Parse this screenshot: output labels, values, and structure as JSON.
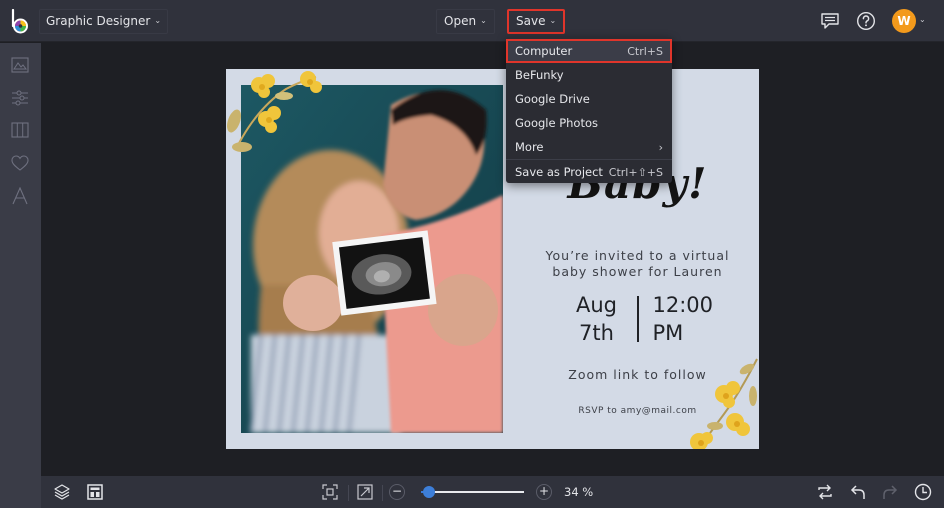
{
  "app": {
    "name": "BeFunky",
    "mode_label": "Graphic Designer"
  },
  "topbar": {
    "open_label": "Open",
    "save_label": "Save",
    "avatar_initial": "W",
    "icons": [
      "befunky-logo-icon",
      "comments-icon",
      "help-icon",
      "avatar"
    ],
    "colors": {
      "highlight": "#e0352b",
      "avatar": "#f39a1c",
      "accent": "#3d7fd9"
    }
  },
  "save_menu": {
    "items": [
      {
        "label": "Computer",
        "shortcut": "Ctrl+S",
        "highlighted": true
      },
      {
        "label": "BeFunky",
        "shortcut": ""
      },
      {
        "label": "Google Drive",
        "shortcut": ""
      },
      {
        "label": "Google Photos",
        "shortcut": ""
      },
      {
        "label": "More",
        "shortcut": "",
        "submenu": true,
        "submenu_glyph": "›"
      },
      {
        "label": "Save as Project",
        "shortcut": "Ctrl+⇧+S"
      }
    ]
  },
  "sidebar": {
    "items": [
      {
        "name": "image-manager",
        "icon": "image-icon"
      },
      {
        "name": "customize",
        "icon": "sliders-icon"
      },
      {
        "name": "layouts",
        "icon": "columns-icon"
      },
      {
        "name": "graphics",
        "icon": "heart-icon"
      },
      {
        "name": "text",
        "icon": "text-icon"
      }
    ]
  },
  "design": {
    "headline": "Baby!",
    "invite_line1": "You’re invited to a virtual",
    "invite_line2": "baby shower for Lauren",
    "date_line1": "Aug",
    "date_line2": "7th",
    "time_line1": "12:00",
    "time_line2": "PM",
    "zoom_note": "Zoom link to follow",
    "rsvp": "RSVP to amy@mail.com"
  },
  "bottombar": {
    "zoom_percent": "34 %",
    "zoom_fraction": 0.08,
    "minus_label": "−",
    "plus_label": "+"
  }
}
